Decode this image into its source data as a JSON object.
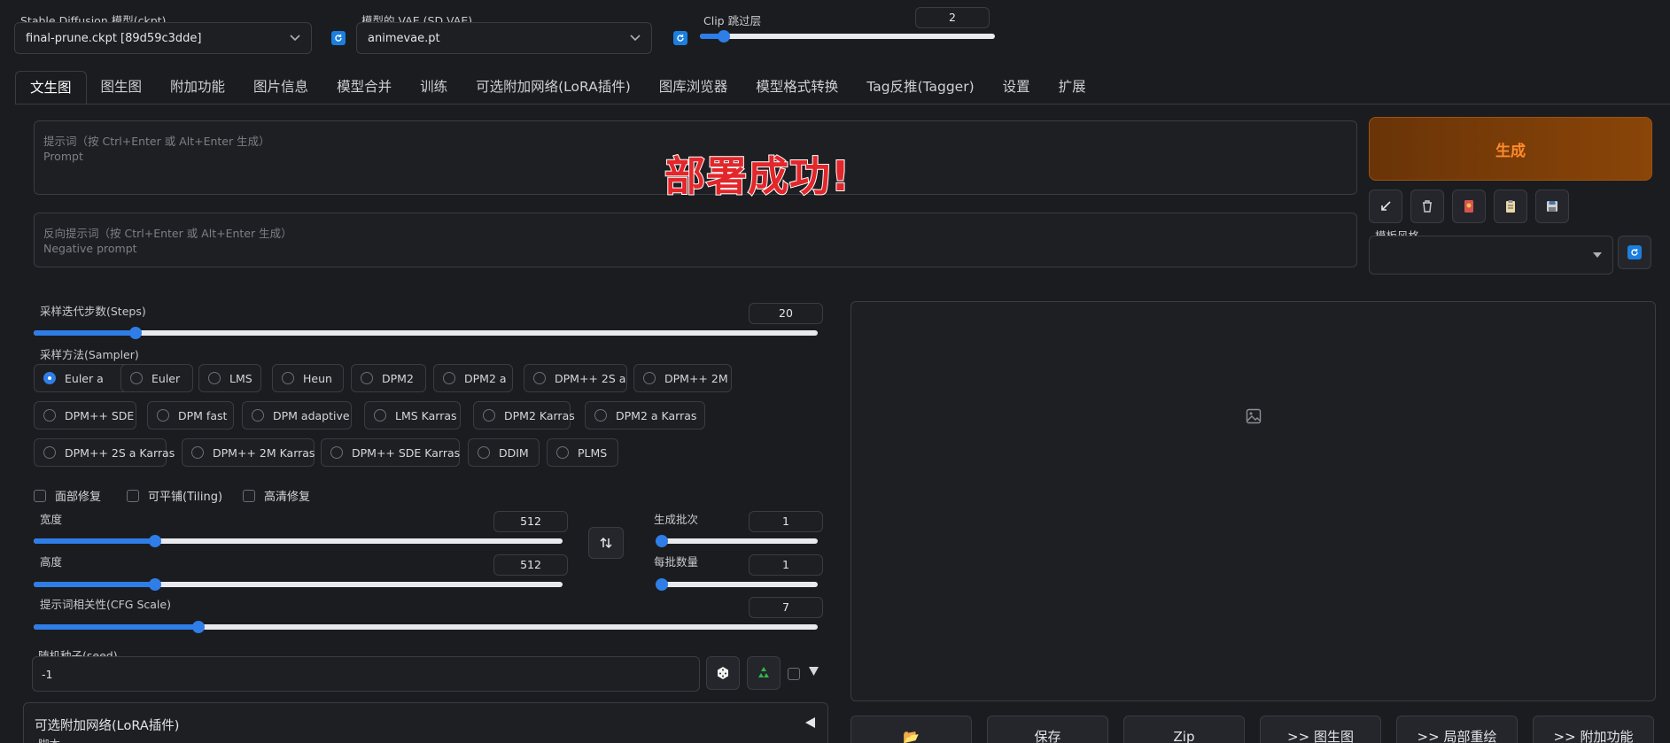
{
  "top": {
    "sd_model_label": "Stable Diffusion 模型(ckpt)",
    "sd_model_value": "final-prune.ckpt [89d59c3dde]",
    "vae_label": "模型的 VAE (SD VAE)",
    "vae_value": "animevae.pt",
    "clip_label": "Clip 跳过层",
    "clip_value": "2",
    "clip_level": 0.08
  },
  "tabs": [
    "文生图",
    "图生图",
    "附加功能",
    "图片信息",
    "模型合并",
    "训练",
    "可选附加网络(LoRA插件)",
    "图库浏览器",
    "模型格式转换",
    "Tag反推(Tagger)",
    "设置",
    "扩展"
  ],
  "prompt": {
    "placeholder_line1": "提示词（按 Ctrl+Enter 或 Alt+Enter 生成）",
    "placeholder_line2": "Prompt",
    "neg_line1": "反向提示词（按 Ctrl+Enter 或 Alt+Enter 生成）",
    "neg_line2": "Negative prompt"
  },
  "overlay_text": "部署成功!",
  "generate": {
    "label": "生成",
    "style_label": "模板风格"
  },
  "steps": {
    "label": "采样迭代步数(Steps)",
    "value": "20",
    "level": 0.13
  },
  "sampler": {
    "label": "采样方法(Sampler)",
    "selected": "Euler a",
    "options": [
      "Euler a",
      "Euler",
      "LMS",
      "Heun",
      "DPM2",
      "DPM2 a",
      "DPM++ 2S a",
      "DPM++ 2M",
      "DPM++ SDE",
      "DPM fast",
      "DPM adaptive",
      "LMS Karras",
      "DPM2 Karras",
      "DPM2 a Karras",
      "DPM++ 2S a Karras",
      "DPM++ 2M Karras",
      "DPM++ SDE Karras",
      "DDIM",
      "PLMS"
    ]
  },
  "checks": {
    "face": "面部修复",
    "tiling": "可平铺(Tiling)",
    "hires": "高清修复"
  },
  "width": {
    "label": "宽度",
    "value": "512",
    "level": 0.23
  },
  "height": {
    "label": "高度",
    "value": "512",
    "level": 0.23
  },
  "batch_count": {
    "label": "生成批次",
    "value": "1",
    "level": 0.0
  },
  "batch_size": {
    "label": "每批数量",
    "value": "1",
    "level": 0.0
  },
  "cfg": {
    "label": "提示词相关性(CFG Scale)",
    "value": "7",
    "level": 0.21
  },
  "seed": {
    "label": "随机种子(seed)",
    "value": "-1"
  },
  "lora": {
    "title": "可选附加网络(LoRA插件)",
    "sub": "脚本"
  },
  "output_buttons": [
    "📂",
    "保存",
    "Zip",
    ">> 图生图",
    ">> 局部重绘",
    ">> 附加功能"
  ],
  "colors": {
    "accent": "#2f7de6",
    "generate_bg": "#7a3b06",
    "generate_text": "#ff8a2b",
    "overlay_red": "#e3262a"
  }
}
